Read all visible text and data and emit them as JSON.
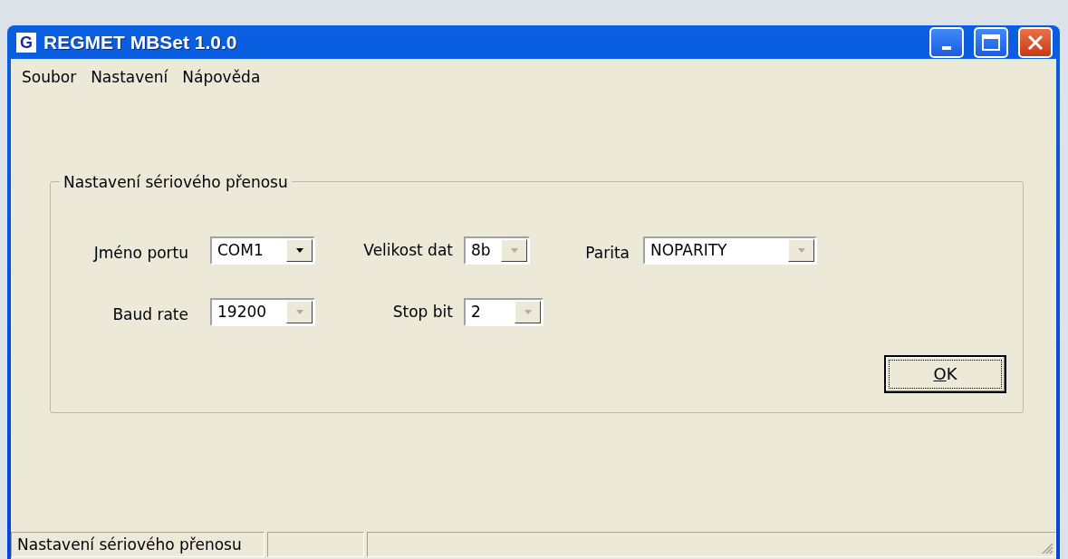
{
  "window": {
    "title": "REGMET MBSet 1.0.0",
    "icon_letter": "G"
  },
  "menu": [
    "Soubor",
    "Nastavení",
    "Nápověda"
  ],
  "group": {
    "title": "Nastavení sériového přenosu",
    "fields": [
      {
        "label": "Jméno portu",
        "value": "COM1",
        "disabled": false
      },
      {
        "label": "Velikost dat",
        "value": "8b",
        "disabled": true
      },
      {
        "label": "Parita",
        "value": "NOPARITY",
        "disabled": true
      },
      {
        "label": "Baud rate",
        "value": "19200",
        "disabled": true
      },
      {
        "label": "Stop bit",
        "value": "2",
        "disabled": true
      }
    ],
    "ok_button": {
      "label": "OK",
      "underline_first_letter": true
    }
  },
  "status_bar": {
    "text": "Nastavení sériového přenosu"
  }
}
